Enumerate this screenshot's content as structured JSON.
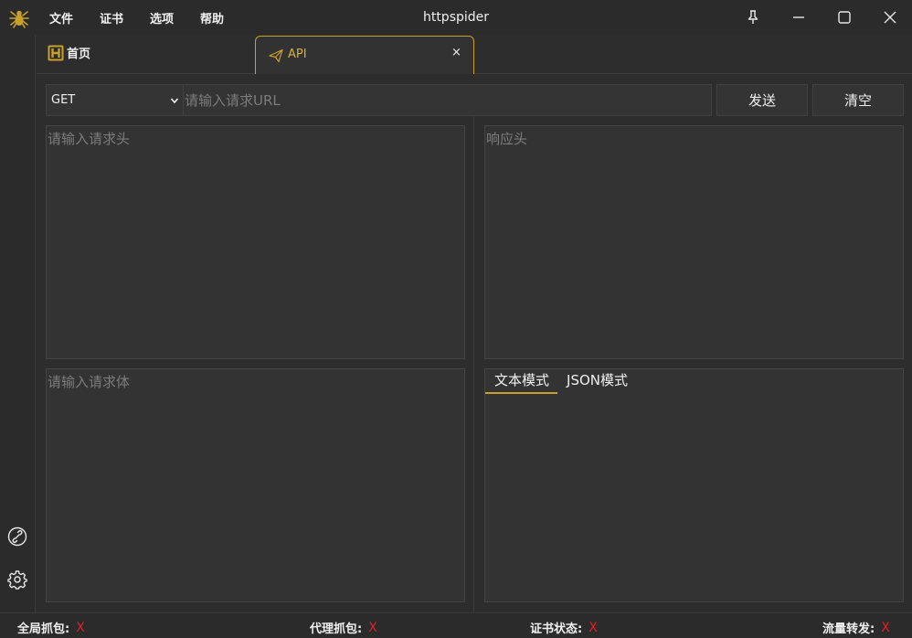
{
  "window": {
    "title": "httpspider"
  },
  "menu": {
    "items": [
      "文件",
      "证书",
      "选项",
      "帮助"
    ]
  },
  "tabs": {
    "home": {
      "label": "首页"
    },
    "api": {
      "label": "API",
      "close": "×"
    }
  },
  "request": {
    "method": "GET",
    "url_placeholder": "请输入请求URL",
    "send_label": "发送",
    "clear_label": "清空",
    "headers_placeholder": "请输入请求头",
    "body_placeholder": "请输入请求体"
  },
  "response": {
    "headers_placeholder": "响应头",
    "mode_tabs": [
      "文本模式",
      "JSON模式"
    ],
    "active_mode": "文本模式"
  },
  "status": {
    "global_capture": {
      "label": "全局抓包:",
      "value": "X"
    },
    "proxy_capture": {
      "label": "代理抓包:",
      "value": "X"
    },
    "cert_status": {
      "label": "证书状态:",
      "value": "X"
    },
    "traffic_forward": {
      "label": "流量转发:",
      "value": "X"
    }
  },
  "colors": {
    "accent": "#c8a02a",
    "error": "#e02020",
    "background": "#2d2d2d"
  },
  "icons": [
    "spider-icon",
    "pin-icon",
    "minimize-icon",
    "maximize-icon",
    "close-icon",
    "link-icon",
    "gear-icon",
    "home-h-icon",
    "paper-plane-icon",
    "chevron-down-icon"
  ]
}
